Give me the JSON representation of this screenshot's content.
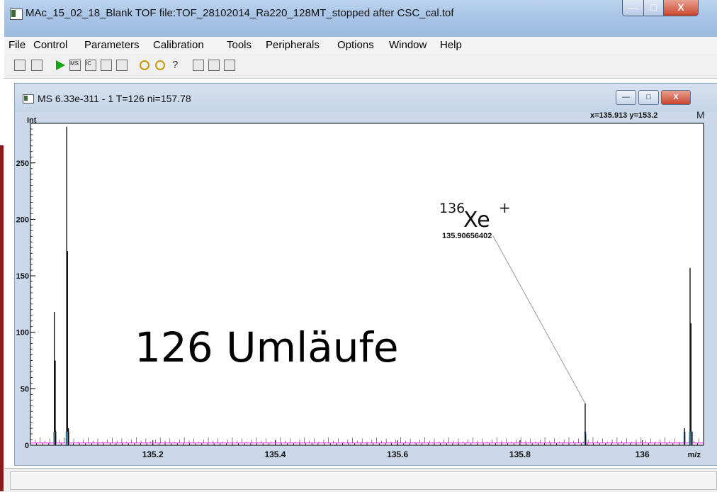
{
  "window": {
    "title": "MAc_15_02_18_Blank   TOF   file:TOF_28102014_Ra220_128MT_stopped after CSC_cal.tof",
    "buttons": {
      "minimize": "—",
      "maximize": "□",
      "close": "X"
    }
  },
  "menu": [
    "File",
    "Control",
    "Parameters",
    "Calibration",
    "Tools",
    "Peripherals",
    "Options",
    "Window",
    "Help"
  ],
  "toolbar": {
    "icons": [
      "open-icon",
      "save-icon",
      "run-icon",
      "ms-spectrum-icon",
      "ic-icon",
      "table-icon",
      "print-icon",
      "undo-icon",
      "redo-icon",
      "help-icon",
      "zoom-icon",
      "marker-m-icon",
      "marker-t-icon"
    ],
    "labels": {
      "ms": "MS",
      "ic": "IC"
    }
  },
  "child_window": {
    "title": "MS  6.33e-311 - 1  T=126 ni=157.78",
    "coord_readout": "x=135.913 y=153.2",
    "corner_mark": "M",
    "buttons": {
      "minimize": "—",
      "maximize": "□",
      "close": "X"
    }
  },
  "colors": {
    "baseline": "#ff33ff",
    "peak_fill": "#5aa6c6",
    "leader_line": "#999999"
  },
  "chart_data": {
    "type": "line",
    "title": "",
    "xlabel": "m/z",
    "ylabel": "Int",
    "xlim": [
      135.0,
      136.1
    ],
    "ylim": [
      0,
      285
    ],
    "xticks": [
      135.2,
      135.4,
      135.6,
      135.8,
      136
    ],
    "x_tick_labels": [
      "135.2",
      "135.4",
      "135.6",
      "135.8",
      "136"
    ],
    "yticks": [
      0,
      50,
      100,
      150,
      200,
      250
    ],
    "y_tick_labels": [
      "0",
      "50",
      "100",
      "150",
      "200",
      "250"
    ],
    "baseline_y": 2,
    "peaks": [
      {
        "x": 135.039,
        "y": 118
      },
      {
        "x": 135.0405,
        "y": 75
      },
      {
        "x": 135.041,
        "y": 13
      },
      {
        "x": 135.0592,
        "y": 282
      },
      {
        "x": 135.0605,
        "y": 172
      },
      {
        "x": 135.062,
        "y": 15
      },
      {
        "x": 135.9066,
        "y": 37
      },
      {
        "x": 135.907,
        "y": 10
      },
      {
        "x": 136.069,
        "y": 15
      },
      {
        "x": 136.078,
        "y": 157
      },
      {
        "x": 136.0795,
        "y": 108
      },
      {
        "x": 136.081,
        "y": 12
      }
    ],
    "annotation": {
      "label_mass": "136",
      "label_element": "Xe",
      "label_charge": "+",
      "value": "135.90656402",
      "peak_x": 135.9066,
      "peak_y": 37
    },
    "overlay_text": "126 Umläufe"
  },
  "statusbar": {
    "text": ""
  }
}
